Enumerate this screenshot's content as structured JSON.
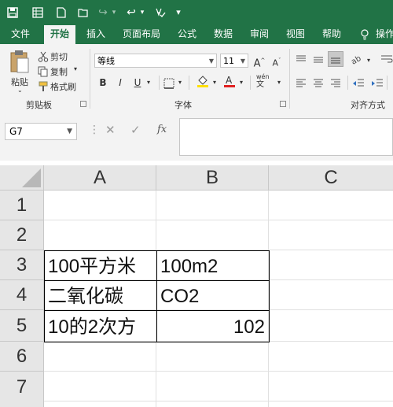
{
  "quick_access": {
    "redo_sep": "▾",
    "more": "▾"
  },
  "tabs": [
    "文件",
    "开始",
    "插入",
    "页面布局",
    "公式",
    "数据",
    "审阅",
    "视图",
    "帮助",
    "操作"
  ],
  "ribbon": {
    "clipboard": {
      "paste": "粘贴",
      "cut": "剪切",
      "copy": "复制",
      "format_painter": "格式刷",
      "group_label": "剪贴板"
    },
    "font": {
      "font_name": "等线",
      "font_size": "11",
      "bold": "B",
      "italic": "I",
      "underline": "U",
      "phonetic": "wén",
      "group_label": "字体"
    },
    "alignment": {
      "group_label": "对齐方式"
    }
  },
  "formula_bar": {
    "name_box": "G7",
    "fx": "fx",
    "formula": ""
  },
  "columns": [
    "A",
    "B",
    "C"
  ],
  "rows": [
    "1",
    "2",
    "3",
    "4",
    "5",
    "6",
    "7"
  ],
  "cells": {
    "A3": "100平方米",
    "B3": "100m2",
    "A4": "二氧化碳",
    "B4": "CO2",
    "A5": "10的2次方",
    "B5": "102"
  },
  "colors": {
    "excel_green": "#217346",
    "font_color_red": "#e02020",
    "highlight_yellow": "#ffe000"
  }
}
